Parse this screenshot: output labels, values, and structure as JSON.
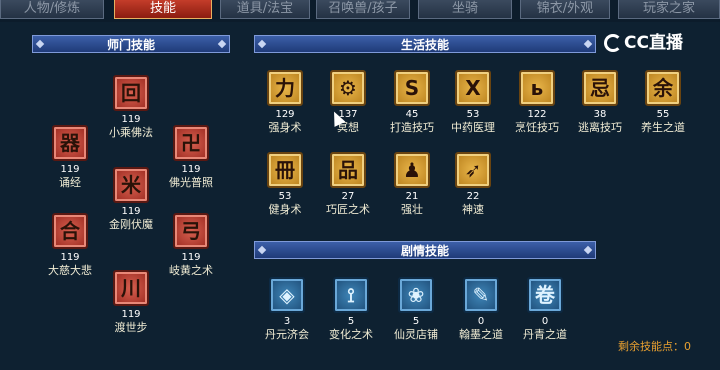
{
  "tabs": [
    "人物/修炼",
    "技能",
    "道具/法宝",
    "召唤兽/孩子",
    "坐骑",
    "锦衣/外观",
    "玩家之家"
  ],
  "logo": "CC直播",
  "sect": {
    "header": "师门技能",
    "skills": [
      {
        "name": "小乘佛法",
        "level": "119"
      },
      {
        "name": "诵经",
        "level": "119"
      },
      {
        "name": "佛光普照",
        "level": "119"
      },
      {
        "name": "金刚伏魔",
        "level": "119"
      },
      {
        "name": "大慈大悲",
        "level": "119"
      },
      {
        "name": "岐黄之术",
        "level": "119"
      },
      {
        "name": "渡世步",
        "level": "119"
      }
    ]
  },
  "life": {
    "header": "生活技能",
    "skills": [
      {
        "name": "强身术",
        "level": "129"
      },
      {
        "name": "冥想",
        "level": "137"
      },
      {
        "name": "打造技巧",
        "level": "45"
      },
      {
        "name": "中药医理",
        "level": "53"
      },
      {
        "name": "烹饪技巧",
        "level": "122"
      },
      {
        "name": "逃离技巧",
        "level": "38"
      },
      {
        "name": "养生之道",
        "level": "55"
      },
      {
        "name": "健身术",
        "level": "53"
      },
      {
        "name": "巧匠之术",
        "level": "27"
      },
      {
        "name": "强壮",
        "level": "21"
      },
      {
        "name": "神速",
        "level": "22"
      }
    ]
  },
  "plot": {
    "header": "剧情技能",
    "skills": [
      {
        "name": "丹元济会",
        "level": "3"
      },
      {
        "name": "变化之术",
        "level": "5"
      },
      {
        "name": "仙灵店铺",
        "level": "5"
      },
      {
        "name": "翰墨之道",
        "level": "0"
      },
      {
        "name": "丹青之道",
        "level": "0"
      }
    ]
  },
  "remaining_label": "剩余技能点：0"
}
